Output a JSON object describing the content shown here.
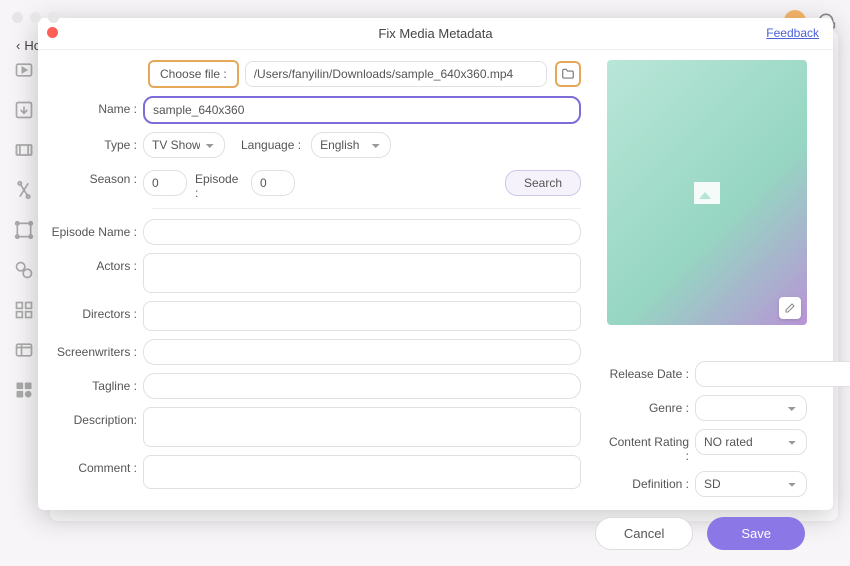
{
  "window": {
    "back": "Ho"
  },
  "modal": {
    "title": "Fix Media Metadata",
    "feedback": "Feedback",
    "close_color": "#ff5f57"
  },
  "file": {
    "choose_label": "Choose file :",
    "path": "/Users/fanyilin/Downloads/sample_640x360.mp4"
  },
  "fields": {
    "name_label": "Name :",
    "name_value": "sample_640x360",
    "type_label": "Type :",
    "type_value": "TV Shows",
    "language_label": "Language :",
    "language_value": "English",
    "season_label": "Season :",
    "season_value": "0",
    "episode_label": "Episode :",
    "episode_value": "0",
    "search": "Search",
    "episode_name_label": "Episode Name :",
    "episode_name_value": "",
    "actors_label": "Actors :",
    "actors_value": "",
    "directors_label": "Directors :",
    "directors_value": "",
    "screenwriters_label": "Screenwriters :",
    "screenwriters_value": "",
    "tagline_label": "Tagline :",
    "tagline_value": "",
    "description_label": "Description:",
    "description_value": "",
    "comment_label": "Comment :",
    "comment_value": ""
  },
  "right": {
    "release_date_label": "Release Date :",
    "release_date_value": "",
    "genre_label": "Genre :",
    "genre_value": "",
    "content_rating_label": "Content Rating :",
    "content_rating_value": "NO rated",
    "definition_label": "Definition :",
    "definition_value": "SD"
  },
  "footer": {
    "cancel": "Cancel",
    "save": "Save"
  },
  "icons": {
    "poster_placeholder": "image-icon",
    "poster_edit": "edit-icon",
    "folder": "folder-icon"
  }
}
